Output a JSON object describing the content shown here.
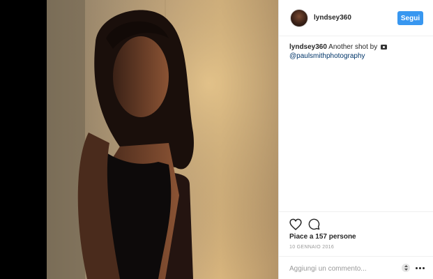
{
  "post": {
    "username": "lyndsey360",
    "follow_label": "Segui",
    "caption": {
      "username": "lyndsey360",
      "text": "Another shot by",
      "camera_icon": "camera-icon",
      "mention": "@paulsmithphotography"
    },
    "likes": "Piace a 157 persone",
    "date": "10 GENNAIO 2016",
    "comment_placeholder": "Aggiungi un commento...",
    "icons": {
      "like": "heart-icon",
      "comment": "comment-icon",
      "sort": "sort-icon",
      "more": "more-icon"
    }
  },
  "colors": {
    "accent": "#3897f0",
    "text": "#262626",
    "muted": "#999999",
    "mention": "#003569",
    "backdrop": "#000000"
  }
}
